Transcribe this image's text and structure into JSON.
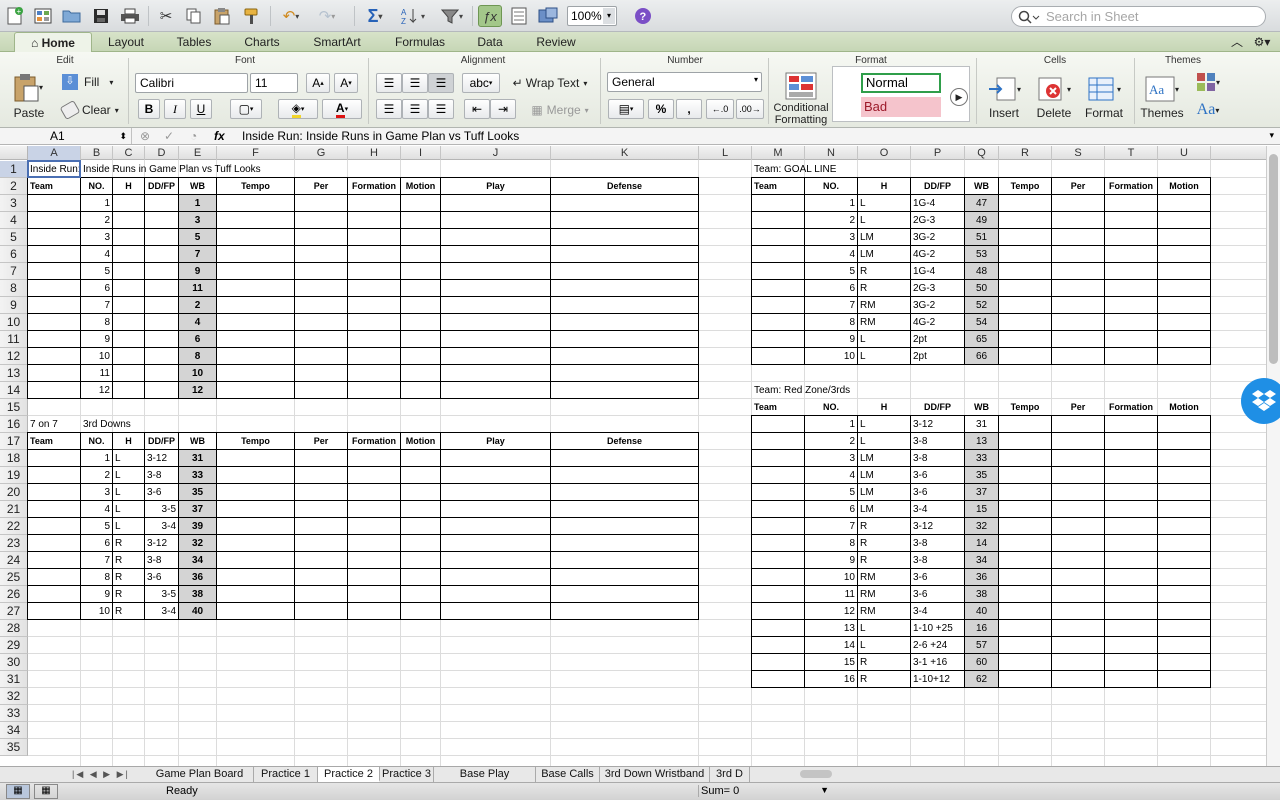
{
  "toolbar": {
    "zoom": "100%",
    "search_placeholder": "Search in Sheet"
  },
  "ribbon_tabs": [
    "Home",
    "Layout",
    "Tables",
    "Charts",
    "SmartArt",
    "Formulas",
    "Data",
    "Review"
  ],
  "ribbon_groups": {
    "edit": "Edit",
    "font": "Font",
    "alignment": "Alignment",
    "number": "Number",
    "format": "Format",
    "cells": "Cells",
    "themes": "Themes"
  },
  "ribbon": {
    "paste": "Paste",
    "fill": "Fill",
    "clear": "Clear",
    "font_name": "Calibri",
    "font_size": "11",
    "wrap_text": "Wrap Text",
    "merge": "Merge",
    "number_format": "General",
    "conditional_formatting_1": "Conditional",
    "conditional_formatting_2": "Formatting",
    "style_normal": "Normal",
    "style_bad": "Bad",
    "insert": "Insert",
    "delete": "Delete",
    "format_btn": "Format",
    "themes_btn": "Themes",
    "bold": "B",
    "italic": "I",
    "underline": "U",
    "abc": "abc",
    "percent": "%",
    "comma": ","
  },
  "formula_bar": {
    "cell_ref": "A1",
    "fx": "fx",
    "content": "Inside Run: Inside Runs in Game Plan vs Tuff Looks"
  },
  "columns": [
    "A",
    "B",
    "C",
    "D",
    "E",
    "F",
    "G",
    "H",
    "I",
    "J",
    "K",
    "L",
    "M",
    "N",
    "O",
    "P",
    "Q",
    "R",
    "S",
    "T",
    "U"
  ],
  "rows": [
    "1",
    "2",
    "3",
    "4",
    "5",
    "6",
    "7",
    "8",
    "9",
    "10",
    "11",
    "12",
    "13",
    "14",
    "15",
    "16",
    "17",
    "18",
    "19",
    "20",
    "21",
    "22",
    "23",
    "24",
    "25",
    "26",
    "27",
    "28",
    "29",
    "30",
    "31",
    "32",
    "33",
    "34",
    "35"
  ],
  "headers": [
    "Team",
    "NO.",
    "H",
    "DD/FP",
    "WB",
    "Tempo",
    "Per",
    "Formation",
    "Motion",
    "Play",
    "Defense"
  ],
  "headers_right": [
    "Team",
    "NO.",
    "H",
    "DD/FP",
    "WB",
    "Tempo",
    "Per",
    "Formation",
    "Motion"
  ],
  "inside_run": {
    "label_a": "Inside Run:",
    "label_b": "Inside Runs in Game Plan vs Tuff Looks",
    "rows": [
      {
        "no": "1",
        "wb": "1"
      },
      {
        "no": "2",
        "wb": "3"
      },
      {
        "no": "3",
        "wb": "5"
      },
      {
        "no": "4",
        "wb": "7"
      },
      {
        "no": "5",
        "wb": "9"
      },
      {
        "no": "6",
        "wb": "11"
      },
      {
        "no": "7",
        "wb": "2"
      },
      {
        "no": "8",
        "wb": "4"
      },
      {
        "no": "9",
        "wb": "6"
      },
      {
        "no": "10",
        "wb": "8"
      },
      {
        "no": "11",
        "wb": "10"
      },
      {
        "no": "12",
        "wb": "12"
      }
    ]
  },
  "seven_on_seven": {
    "label_a": "7 on 7",
    "label_b": "3rd Downs",
    "rows": [
      {
        "no": "1",
        "h": "L",
        "dd": "3-12",
        "wb": "31",
        "ddr": false
      },
      {
        "no": "2",
        "h": "L",
        "dd": "3-8",
        "wb": "33",
        "ddr": false
      },
      {
        "no": "3",
        "h": "L",
        "dd": "3-6",
        "wb": "35",
        "ddr": false
      },
      {
        "no": "4",
        "h": "L",
        "dd": "3-5",
        "wb": "37",
        "ddr": true
      },
      {
        "no": "5",
        "h": "L",
        "dd": "3-4",
        "wb": "39",
        "ddr": true
      },
      {
        "no": "6",
        "h": "R",
        "dd": "3-12",
        "wb": "32",
        "ddr": false
      },
      {
        "no": "7",
        "h": "R",
        "dd": "3-8",
        "wb": "34",
        "ddr": false
      },
      {
        "no": "8",
        "h": "R",
        "dd": "3-6",
        "wb": "36",
        "ddr": false
      },
      {
        "no": "9",
        "h": "R",
        "dd": "3-5",
        "wb": "38",
        "ddr": true
      },
      {
        "no": "10",
        "h": "R",
        "dd": "3-4",
        "wb": "40",
        "ddr": true
      }
    ]
  },
  "goal_line": {
    "label": "Team:  GOAL LINE",
    "rows": [
      {
        "no": "1",
        "h": "L",
        "dd": "1G-4",
        "wb": "47"
      },
      {
        "no": "2",
        "h": "L",
        "dd": "2G-3",
        "wb": "49"
      },
      {
        "no": "3",
        "h": "LM",
        "dd": "3G-2",
        "wb": "51"
      },
      {
        "no": "4",
        "h": "LM",
        "dd": "4G-2",
        "wb": "53"
      },
      {
        "no": "5",
        "h": "R",
        "dd": "1G-4",
        "wb": "48"
      },
      {
        "no": "6",
        "h": "R",
        "dd": "2G-3",
        "wb": "50"
      },
      {
        "no": "7",
        "h": "RM",
        "dd": "3G-2",
        "wb": "52"
      },
      {
        "no": "8",
        "h": "RM",
        "dd": "4G-2",
        "wb": "54"
      },
      {
        "no": "9",
        "h": "L",
        "dd": "2pt",
        "wb": "65"
      },
      {
        "no": "10",
        "h": "L",
        "dd": "2pt",
        "wb": "66"
      }
    ]
  },
  "red_zone": {
    "label": "Team:  Red Zone/3rds",
    "rows": [
      {
        "no": "1",
        "h": "L",
        "dd": "3-12",
        "wb": "31"
      },
      {
        "no": "2",
        "h": "L",
        "dd": "3-8",
        "wb": "13"
      },
      {
        "no": "3",
        "h": "LM",
        "dd": "3-8",
        "wb": "33"
      },
      {
        "no": "4",
        "h": "LM",
        "dd": "3-6",
        "wb": "35"
      },
      {
        "no": "5",
        "h": "LM",
        "dd": "3-6",
        "wb": "37"
      },
      {
        "no": "6",
        "h": "LM",
        "dd": "3-4",
        "wb": "15"
      },
      {
        "no": "7",
        "h": "R",
        "dd": "3-12",
        "wb": "32"
      },
      {
        "no": "8",
        "h": "R",
        "dd": "3-8",
        "wb": "14"
      },
      {
        "no": "9",
        "h": "R",
        "dd": "3-8",
        "wb": "34"
      },
      {
        "no": "10",
        "h": "RM",
        "dd": "3-6",
        "wb": "36"
      },
      {
        "no": "11",
        "h": "RM",
        "dd": "3-6",
        "wb": "38"
      },
      {
        "no": "12",
        "h": "RM",
        "dd": "3-4",
        "wb": "40"
      },
      {
        "no": "13",
        "h": "L",
        "dd": "1-10 +25",
        "wb": "16"
      },
      {
        "no": "14",
        "h": "L",
        "dd": "2-6 +24",
        "wb": "57"
      },
      {
        "no": "15",
        "h": "R",
        "dd": "3-1 +16",
        "wb": "60"
      },
      {
        "no": "16",
        "h": "R",
        "dd": "1-10+12",
        "wb": "62"
      }
    ]
  },
  "sheet_tabs": [
    "Game Plan Board",
    "Practice 1",
    "Practice 2",
    "Practice 3",
    "Base Play Wristband",
    "Base Calls",
    "3rd Down Wristband",
    "3rd D"
  ],
  "active_sheet": "Practice 2",
  "status": {
    "ready": "Ready",
    "sum": "Sum= 0"
  },
  "colors": {
    "ribbon_green": "#c6d6b6",
    "wb_fill": "#d4d4d4",
    "selection": "#c9d3e6"
  }
}
